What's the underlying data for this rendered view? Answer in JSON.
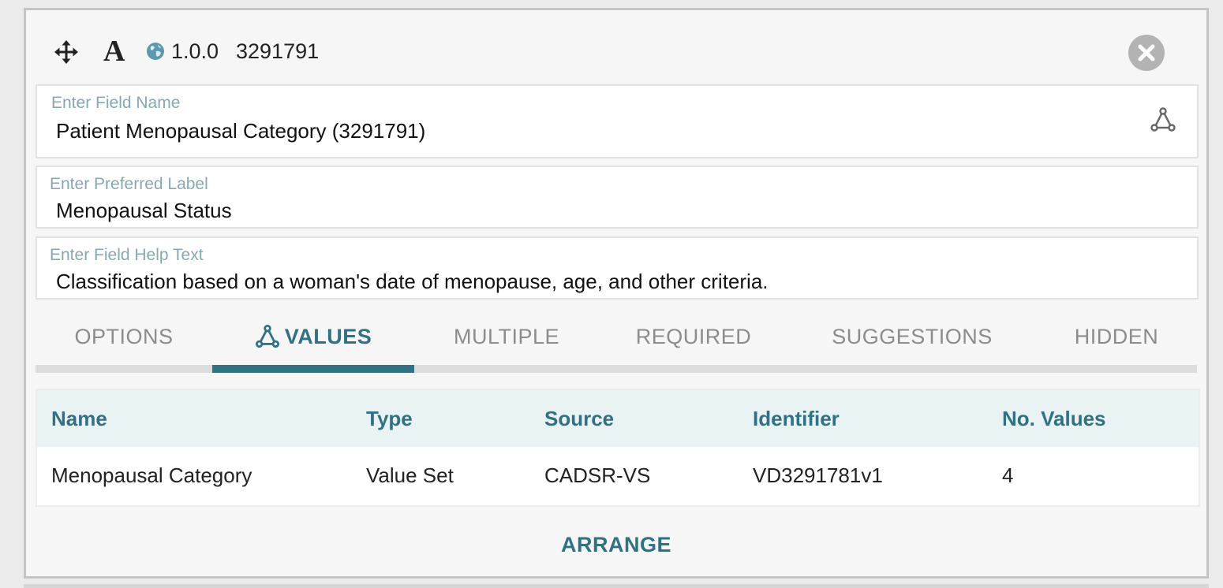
{
  "header": {
    "move_icon": "move-icon",
    "font_icon_glyph": "A",
    "globe_icon": "globe-icon",
    "version": "1.0.0",
    "identifier": "3291791",
    "close_icon": "close-icon"
  },
  "fields": {
    "name": {
      "label": "Enter Field Name",
      "value": "Patient Menopausal Category (3291791)",
      "icon": "tree-icon"
    },
    "preferred_label": {
      "label": "Enter Preferred Label",
      "value": "Menopausal Status"
    },
    "help_text": {
      "label": "Enter Field Help Text",
      "value": "Classification based on a woman's date of menopause, age, and other criteria."
    }
  },
  "tabs": [
    {
      "label": "OPTIONS",
      "active": false
    },
    {
      "label": "VALUES",
      "active": true,
      "icon": "tree-icon"
    },
    {
      "label": "MULTIPLE",
      "active": false
    },
    {
      "label": "REQUIRED",
      "active": false
    },
    {
      "label": "SUGGESTIONS",
      "active": false
    },
    {
      "label": "HIDDEN",
      "active": false
    }
  ],
  "values_table": {
    "columns": [
      "Name",
      "Type",
      "Source",
      "Identifier",
      "No. Values"
    ],
    "rows": [
      [
        "Menopausal Category",
        "Value Set",
        "CADSR-VS",
        "VD3291781v1",
        "4"
      ]
    ]
  },
  "actions": {
    "arrange_label": "ARRANGE"
  },
  "colors": {
    "accent": "#2f7284",
    "label": "#86a8b5",
    "tab_inactive": "#8c8c8c",
    "close_bg": "#b3b3b3",
    "table_header_bg": "#eaf3f3"
  }
}
